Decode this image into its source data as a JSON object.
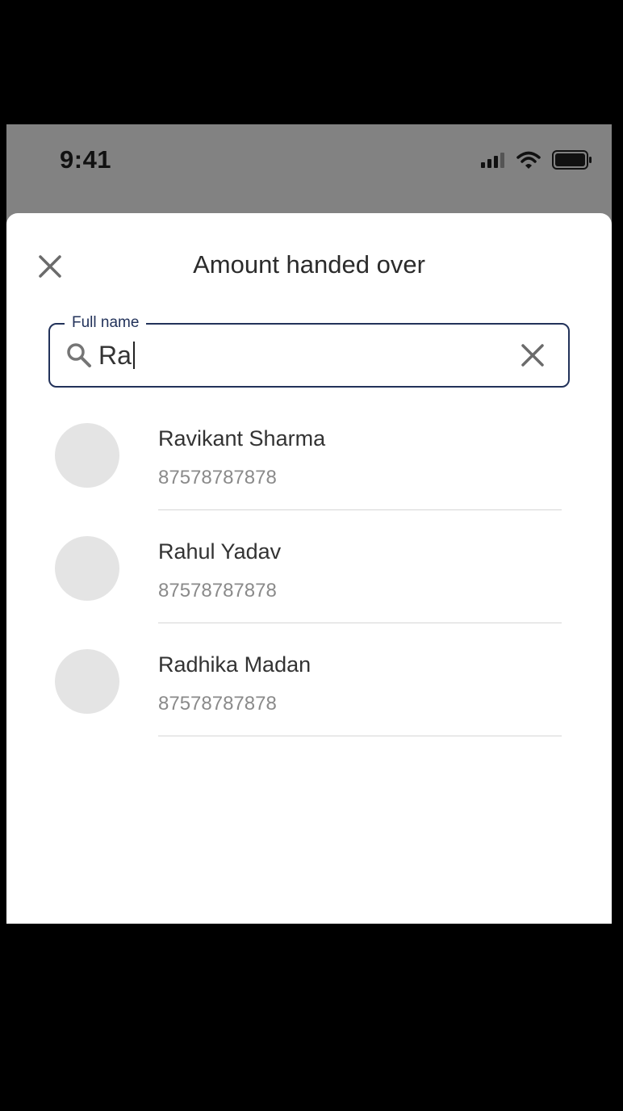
{
  "status_bar": {
    "time": "9:41",
    "icons": [
      "cellular-signal-icon",
      "wifi-icon",
      "battery-icon"
    ]
  },
  "sheet": {
    "title": "Amount handed over",
    "close_icon": "close-icon"
  },
  "search": {
    "label": "Full name",
    "value": "Ra",
    "icon": "search-icon",
    "clear_icon": "clear-icon"
  },
  "results": [
    {
      "name": "Ravikant Sharma",
      "phone": "87578787878"
    },
    {
      "name": "Rahul Yadav",
      "phone": "87578787878"
    },
    {
      "name": "Radhika Madan",
      "phone": "87578787878"
    }
  ],
  "colors": {
    "accent": "#22325a",
    "avatar_placeholder": "#e4e4e4",
    "status_bar_bg": "#828282"
  }
}
